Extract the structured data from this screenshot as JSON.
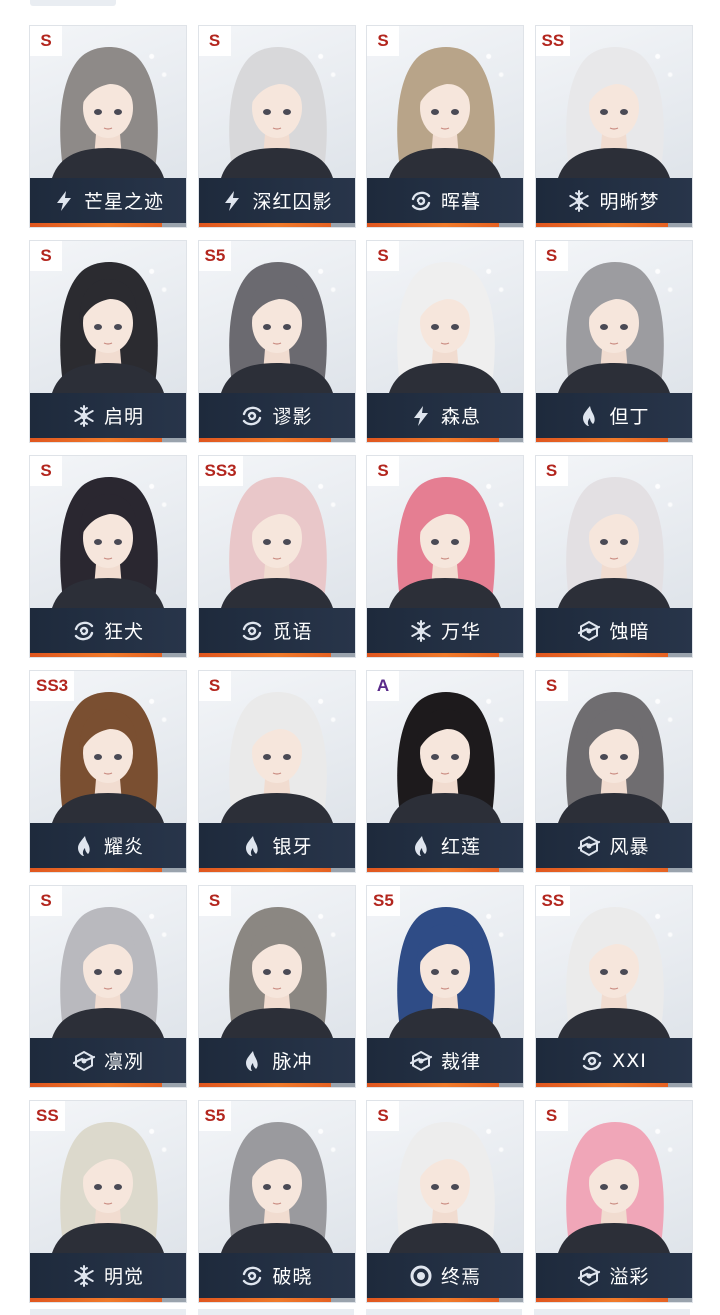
{
  "characters": [
    {
      "rank": "S",
      "name": "芒星之迹",
      "element": "lightning-icon",
      "hair": "#8e8a88"
    },
    {
      "rank": "S",
      "name": "深红囚影",
      "element": "lightning-icon",
      "hair": "#d8d8da"
    },
    {
      "rank": "S",
      "name": "晖暮",
      "element": "swirl-icon",
      "hair": "#b8a489"
    },
    {
      "rank": "SS",
      "name": "明晰梦",
      "element": "snowflake-icon",
      "hair": "#e8e8ea"
    },
    {
      "rank": "S",
      "name": "启明",
      "element": "snowflake-icon",
      "hair": "#2b2b30"
    },
    {
      "rank": "S5",
      "name": "谬影",
      "element": "swirl-icon",
      "hair": "#6b6a70"
    },
    {
      "rank": "S",
      "name": "森息",
      "element": "lightning-icon",
      "hair": "#efefef"
    },
    {
      "rank": "S",
      "name": "但丁",
      "element": "flame-icon",
      "hair": "#9c9ca0"
    },
    {
      "rank": "S",
      "name": "狂犬",
      "element": "swirl-icon",
      "hair": "#2a2730"
    },
    {
      "rank": "SS3",
      "name": "觅语",
      "element": "swirl-icon",
      "hair": "#e9c7c9"
    },
    {
      "rank": "S",
      "name": "万华",
      "element": "snowflake-icon",
      "hair": "#e57e92"
    },
    {
      "rank": "S",
      "name": "蚀暗",
      "element": "hexagon-icon",
      "hair": "#e3e0e3"
    },
    {
      "rank": "SS3",
      "name": "耀炎",
      "element": "flame-icon",
      "hair": "#7a4f31"
    },
    {
      "rank": "S",
      "name": "银牙",
      "element": "flame-icon",
      "hair": "#eaeaea"
    },
    {
      "rank": "A",
      "name": "红莲",
      "element": "flame-icon",
      "hair": "#1d1a1c"
    },
    {
      "rank": "S",
      "name": "风暴",
      "element": "hexagon-icon",
      "hair": "#6f6d70"
    },
    {
      "rank": "S",
      "name": "凛冽",
      "element": "hexagon-icon",
      "hair": "#b9b9be"
    },
    {
      "rank": "S",
      "name": "脉冲",
      "element": "flame-icon",
      "hair": "#8b8782"
    },
    {
      "rank": "S5",
      "name": "裁律",
      "element": "hexagon-icon",
      "hair": "#2f4c86"
    },
    {
      "rank": "SS",
      "name": "XXI",
      "element": "swirl-icon",
      "hair": "#ebebeb"
    },
    {
      "rank": "SS",
      "name": "明觉",
      "element": "snowflake-icon",
      "hair": "#dcd9cc"
    },
    {
      "rank": "S5",
      "name": "破晓",
      "element": "swirl-icon",
      "hair": "#9a9a9e"
    },
    {
      "rank": "S",
      "name": "终焉",
      "element": "ring-icon",
      "hair": "#ededed"
    },
    {
      "rank": "S",
      "name": "溢彩",
      "element": "hexagon-icon",
      "hair": "#f0a6b8"
    }
  ],
  "colors": {
    "namebar": "#1e2a3c",
    "accent": "#e0561f",
    "rank_text": "#b3261e",
    "rank_a_text": "#5a2a8a"
  }
}
